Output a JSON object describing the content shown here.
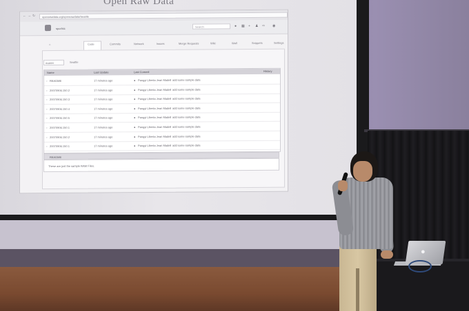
{
  "screen": {
    "title": "Open Raw Data"
  },
  "browser": {
    "url": "openrawdata.org/openrawdata/Seattle",
    "site_name": "sportsic",
    "search_placeholder": "Search",
    "tabs": [
      "Code",
      "Commits",
      "Network",
      "Issues",
      "Merge Requests",
      "Wiki",
      "Wall",
      "Snippets",
      "Settings"
    ],
    "branch": "master",
    "breadcrumb": "Seattle",
    "table": {
      "headers": [
        "Name",
        "Last Update",
        "Last Commit"
      ],
      "history_label": "History",
      "rows": [
        {
          "name": "README",
          "updated": "17 minutes ago",
          "author": "Pangyi Liberta Jean Madell",
          "message": "add some sample data"
        },
        {
          "name": "20070906.150.2",
          "updated": "17 minutes ago",
          "author": "Pangyi Liberta Jean Madell",
          "message": "add some sample data"
        },
        {
          "name": "20070906.150.3",
          "updated": "17 minutes ago",
          "author": "Pangyi Liberta Jean Madell",
          "message": "add some sample data"
        },
        {
          "name": "20070906.150.4",
          "updated": "17 minutes ago",
          "author": "Pangyi Liberta Jean Madell",
          "message": "add some sample data"
        },
        {
          "name": "20070906.150.5",
          "updated": "17 minutes ago",
          "author": "Pangyi Liberta Jean Madell",
          "message": "add some sample data"
        },
        {
          "name": "20070906.150.1",
          "updated": "17 minutes ago",
          "author": "Pangyi Liberta Jean Madell",
          "message": "add some sample data"
        },
        {
          "name": "20070906.150.2",
          "updated": "17 minutes ago",
          "author": "Pangyi Liberta Jean Madell",
          "message": "add some sample data"
        },
        {
          "name": "20070906.150.1",
          "updated": "17 minutes ago",
          "author": "Pangyi Liberta Jean Madell",
          "message": "add some sample data"
        }
      ]
    },
    "readme": {
      "title": "README",
      "body": "These are just the sample RAW Files."
    }
  },
  "icons": {
    "back": "arrow-left-icon",
    "forward": "arrow-right-icon",
    "reload": "reload-icon",
    "laptop_logo": "apple-logo-icon"
  },
  "colors": {
    "screen": "#e6e4e9",
    "curtain": "#18171a",
    "floor": "#7a4a30",
    "hoodie": "#98999f",
    "pants": "#d2c19d"
  }
}
